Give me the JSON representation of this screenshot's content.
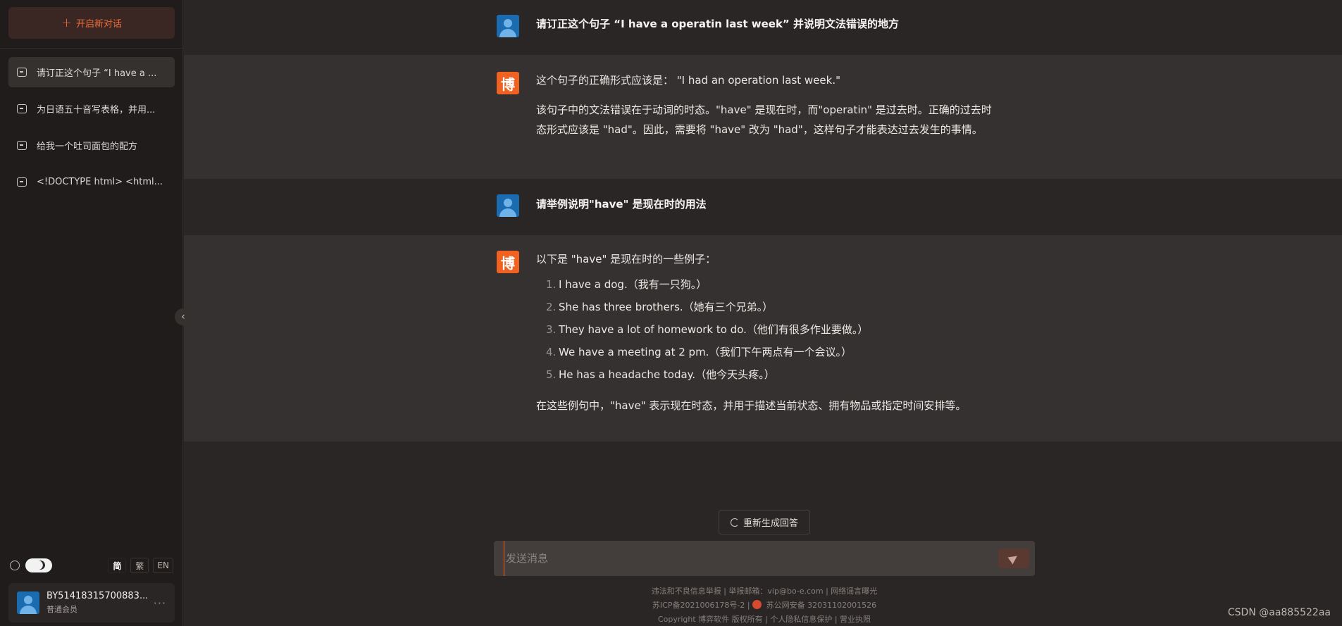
{
  "sidebar": {
    "new_chat_label": "开启新对话",
    "conversations": [
      {
        "title": "请订正这个句子 “I have a ..."
      },
      {
        "title": "为日语五十音写表格，并用..."
      },
      {
        "title": "给我一个吐司面包的配方"
      },
      {
        "title": "<!DOCTYPE html> <html..."
      }
    ],
    "languages": [
      "简",
      "繁",
      "EN"
    ],
    "selected_language": "简",
    "user": {
      "name": "BY51418315700883...",
      "role": "普通会员"
    }
  },
  "chat": {
    "messages": [
      {
        "role": "user",
        "text": "请订正这个句子 “I have a operatin last week” 并说明文法错误的地方"
      },
      {
        "role": "assistant",
        "paragraphs": [
          "这个句子的正确形式应该是： \"I had an operation last week.\"",
          "该句子中的文法错误在于动词的时态。\"have\" 是现在时，而\"operatin\" 是过去时。正确的过去时态形式应该是 \"had\"。因此，需要将 \"have\" 改为 \"had\"，这样句子才能表达过去发生的事情。"
        ]
      },
      {
        "role": "user",
        "text": "请举例说明\"have\" 是现在时的用法"
      },
      {
        "role": "assistant",
        "intro": "以下是 \"have\" 是现在时的一些例子：",
        "list": [
          "I have a dog.（我有一只狗。）",
          "She has three brothers.（她有三个兄弟。）",
          "They have a lot of homework to do.（他们有很多作业要做。）",
          "We have a meeting at 2 pm.（我们下午两点有一个会议。）",
          "He has a headache today.（他今天头疼。）"
        ],
        "outro": "在这些例句中，\"have\" 表示现在时态，并用于描述当前状态、拥有物品或指定时间安排等。"
      }
    ],
    "bot_logo_char": "博",
    "regenerate_label": "重新生成回答",
    "input_placeholder": "发送消息",
    "input_value": ""
  },
  "footer": {
    "line1": "违法和不良信息举报 | 举报邮箱：vip@bo-e.com | 网络谣言曝光",
    "line2_a": "苏ICP备2021006178号-2 |",
    "line2_b": "苏公网安备 32031102001526",
    "line3": "Copyright 博弈软件 版权所有 | 个人隐私信息保护 | 营业执照"
  },
  "watermark": "CSDN @aa885522aa",
  "colors": {
    "accent": "#ef6222",
    "sidebar_bg": "#1f1c1b",
    "user_msg_bg": "#2a2625",
    "bot_msg_bg": "#353130"
  }
}
